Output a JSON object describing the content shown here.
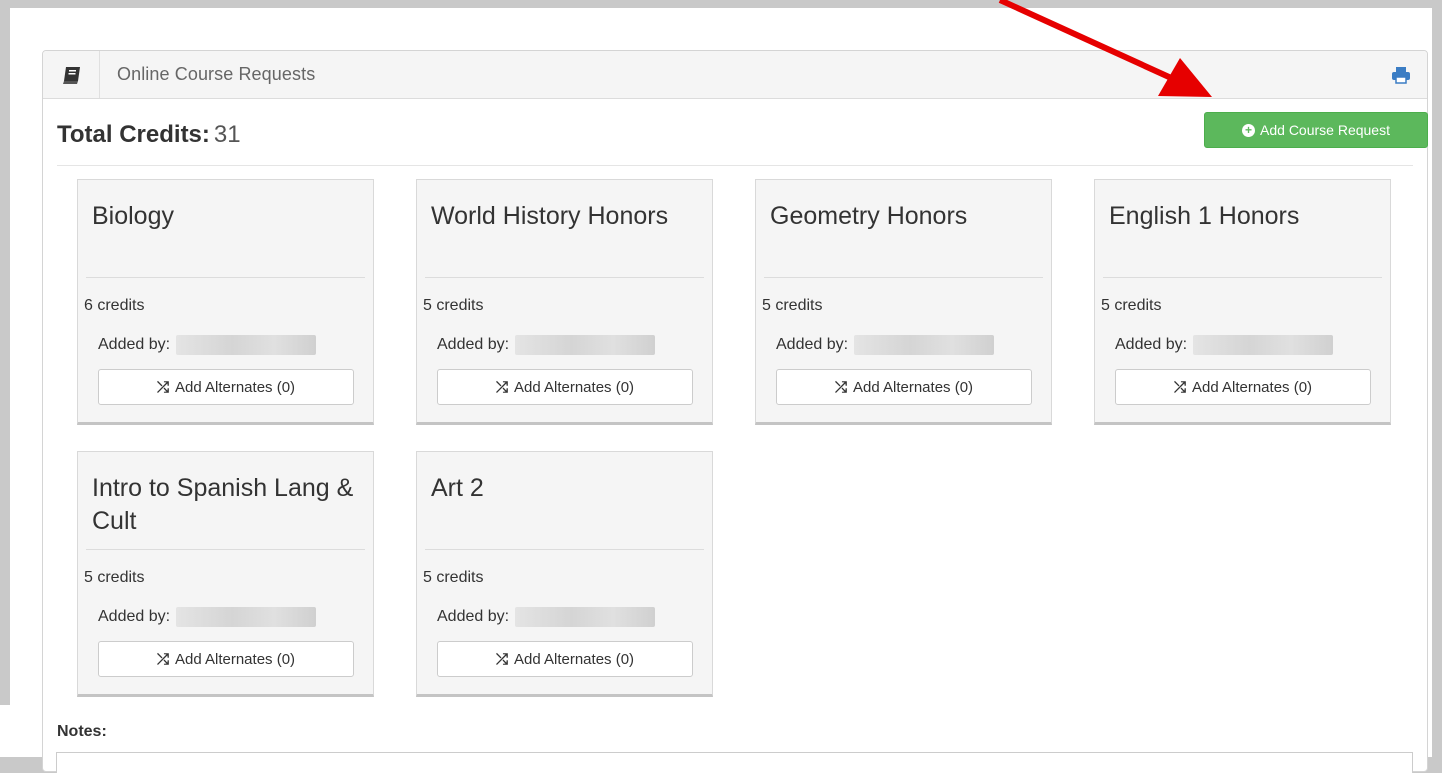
{
  "panel": {
    "title": "Online Course Requests",
    "icons": {
      "header": "book-icon",
      "print": "print-icon"
    }
  },
  "totals": {
    "label": "Total Credits:",
    "value": "31"
  },
  "add_request": {
    "label": "Add Course Request",
    "icon": "plus-circle-icon",
    "color": "#5cb85c"
  },
  "courses": [
    {
      "title": "Biology",
      "credits": "6 credits",
      "added_by_label": "Added by:",
      "alternates_label": "Add Alternates (0)"
    },
    {
      "title": "World History Honors",
      "credits": "5 credits",
      "added_by_label": "Added by:",
      "alternates_label": "Add Alternates (0)"
    },
    {
      "title": "Geometry Honors",
      "credits": "5 credits",
      "added_by_label": "Added by:",
      "alternates_label": "Add Alternates (0)"
    },
    {
      "title": "English 1 Honors",
      "credits": "5 credits",
      "added_by_label": "Added by:",
      "alternates_label": "Add Alternates (0)"
    },
    {
      "title": "Intro to Spanish Lang & Cult",
      "credits": "5 credits",
      "added_by_label": "Added by:",
      "alternates_label": "Add Alternates (0)"
    },
    {
      "title": "Art 2",
      "credits": "5 credits",
      "added_by_label": "Added by:",
      "alternates_label": "Add Alternates (0)"
    }
  ],
  "notes": {
    "label": "Notes:"
  },
  "annotation": {
    "arrow_color": "#e60000"
  }
}
